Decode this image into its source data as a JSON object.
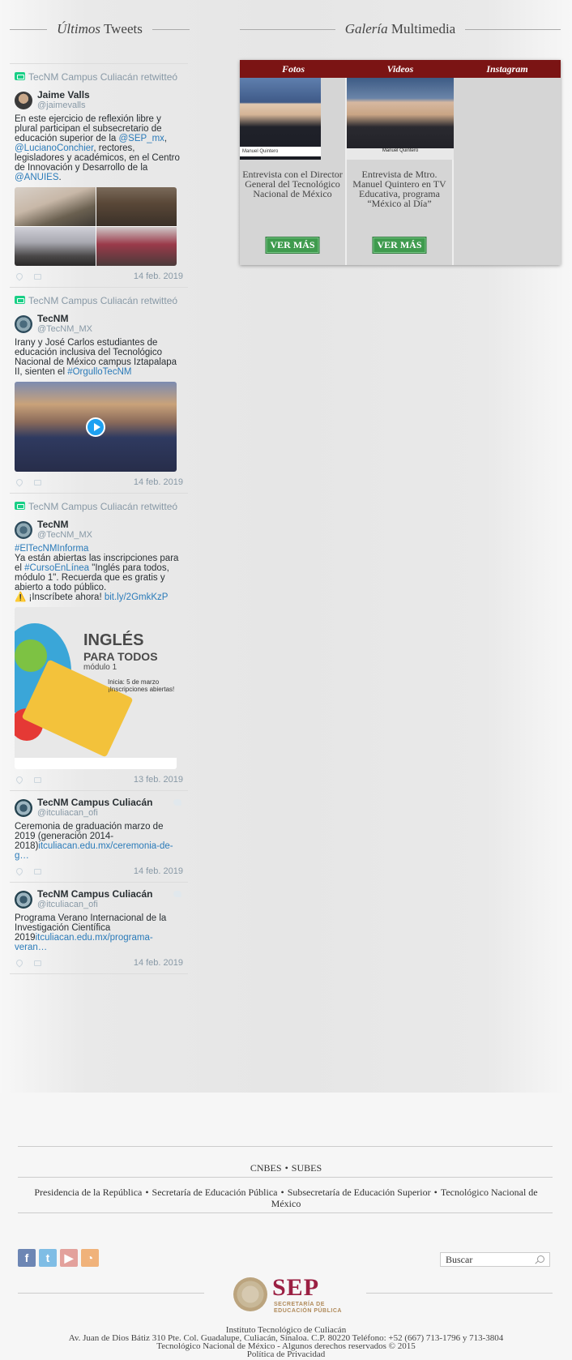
{
  "tweets_header": {
    "italic": "Últimos",
    "rest": " Tweets"
  },
  "gallery_header": {
    "italic": "Galería",
    "rest": " Multimedia"
  },
  "tweets": [
    {
      "retweet_label": "TecNM Campus Culiacán retwitteó",
      "author_name": "Jaime Valls",
      "author_handle": "@jaimevalls",
      "text_parts": [
        "En este ejercicio de reflexión libre y plural participan el subsecretario de educación superior de la ",
        "@SEP_mx",
        ", ",
        "@LucianoConchier",
        ", rectores, legisladores y académicos, en el Centro de Innovación y Desarrollo de la ",
        "@ANUIES",
        "."
      ],
      "date": "14 feb. 2019"
    },
    {
      "retweet_label": "TecNM Campus Culiacán retwitteó",
      "author_name": "TecNM",
      "author_handle": "@TecNM_MX",
      "text_parts": [
        "Irany y José Carlos estudiantes de educación inclusiva del Tecnológico Nacional de México campus Iztapalapa II, sienten el ",
        "#OrgulloTecNM"
      ],
      "date": "14 feb. 2019"
    },
    {
      "retweet_label": "TecNM Campus Culiacán retwitteó",
      "author_name": "TecNM",
      "author_handle": "@TecNM_MX",
      "text_parts": [
        "#ElTecNMInforma",
        "Ya están abiertas las inscripciones para el ",
        "#CursoEnLínea",
        " \"Inglés para todos, módulo 1\". Recuerda que es gratis y abierto a todo público.",
        "⚠️ ¡Inscríbete ahora! ",
        "bit.ly/2GmkKzP"
      ],
      "media_text": {
        "t1": "INGLÉS",
        "t2": "PARA TODOS",
        "t3": "módulo 1",
        "date_line": "Inicia: 5 de marzo",
        "date_sub": "¡Inscripciones abiertas!"
      },
      "date": "13 feb. 2019"
    },
    {
      "author_name": "TecNM Campus Culiacán",
      "author_handle": "@itculiacan_ofi",
      "text_parts": [
        "Ceremonia de graduación marzo de 2019 (generación 2014-2018)",
        "itculiacan.edu.mx/ceremonia-de-g…"
      ],
      "date": "14 feb. 2019"
    },
    {
      "author_name": "TecNM Campus Culiacán",
      "author_handle": "@itculiacan_ofi",
      "text_parts": [
        "Programa Verano Internacional de la Investigación Científica 2019",
        "itculiacan.edu.mx/programa-veran…"
      ],
      "date": "14 feb. 2019"
    }
  ],
  "gallery": {
    "tabs": [
      "Fotos",
      "Videos",
      "Instagram"
    ],
    "items": [
      {
        "caption": "Entrevista con el Director General del Tecnológico Nacional de México",
        "button": "VER MÁS",
        "tv_text": "Manuel Quintero"
      },
      {
        "caption": "Entrevista de Mtro. Manuel Quintero en TV Educativa, programa “México al Día”",
        "button": "VER MÁS",
        "tv_text": "Manuel Quintero"
      }
    ]
  },
  "footer": {
    "links1": [
      "CNBES",
      "SUBES"
    ],
    "links2": [
      "Presidencia de la República",
      "Secretaría de Educación Pública",
      "Subsecretaría de Educación Superior",
      "Tecnológico Nacional de México"
    ],
    "search_placeholder": "Buscar",
    "sep_word": "SEP",
    "sep_sub1": "SECRETARÍA DE",
    "sep_sub2": "EDUCACIÓN PÚBLICA",
    "address": [
      "Instituto Tecnológico de Culiacán",
      "Av. Juan de Dios Bátiz 310 Pte. Col. Guadalupe, Culiacán, Sinaloa. C.P. 80220 Teléfono: +52 (667) 713-1796 y 713-3804",
      "Tecnológico Nacional de México - Algunos derechos reservados © 2015",
      "Política de Privacidad"
    ]
  }
}
